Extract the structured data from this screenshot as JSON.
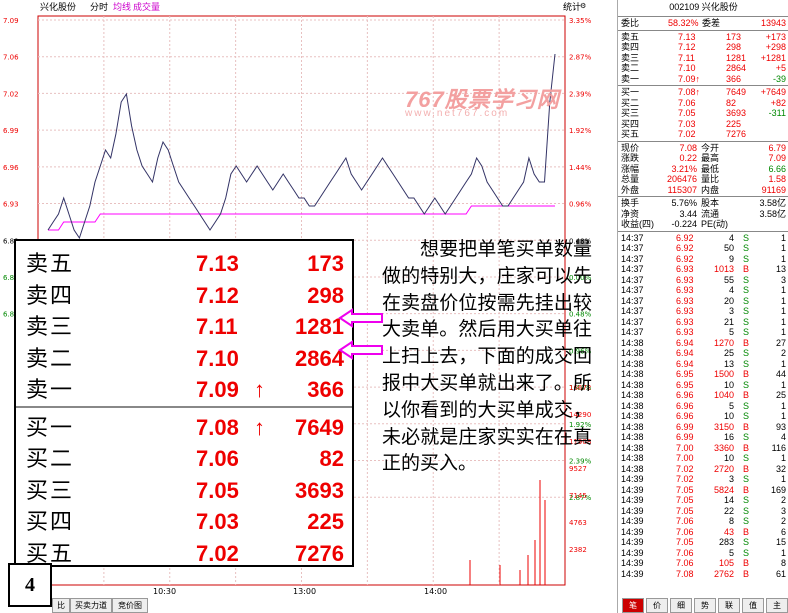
{
  "header": {
    "stock": "兴化股份",
    "tab_timeshare": "分时",
    "legend_avg": "均线",
    "legend_vol": "成交量",
    "stats_btn": "统计"
  },
  "chart_data": {
    "type": "line",
    "y_left_ticks": [
      "7.09",
      "7.06",
      "7.02",
      "6.99",
      "6.96",
      "6.93",
      "6.89",
      "6.86",
      "6.83"
    ],
    "y_right_ticks": [
      "3.35%",
      "2.87%",
      "2.39%",
      "1.92%",
      "1.44%",
      "0.96%",
      "0.48%",
      "0.00%",
      "0.48%",
      "0.96%",
      "1.44%",
      "1.92%",
      "2.39%",
      "2.87%"
    ],
    "vol_ticks": [
      "16672",
      "14290",
      "11908",
      "9527",
      "7145",
      "4763",
      "2382"
    ],
    "x_ticks": [
      "10:30",
      "13:00",
      "14:00"
    ],
    "ylim": [
      6.8,
      7.1
    ],
    "price": [
      6.86,
      6.87,
      6.88,
      6.9,
      6.88,
      6.86,
      6.85,
      6.87,
      6.89,
      6.92,
      6.94,
      6.96,
      6.95,
      6.98,
      7.02,
      7.03,
      6.99,
      6.96,
      6.94,
      6.93,
      6.92,
      6.95,
      6.97,
      6.96,
      6.94,
      6.92,
      6.91,
      6.9,
      6.89,
      6.88,
      6.87,
      6.86,
      6.87,
      6.88,
      6.9,
      6.93,
      6.94,
      6.93,
      6.92,
      6.93,
      6.94,
      6.93,
      6.92,
      6.91,
      6.92,
      6.93,
      6.92,
      6.91,
      6.9,
      6.9,
      6.89,
      6.89,
      6.9,
      6.91,
      6.92,
      6.93,
      6.94,
      6.95,
      6.93,
      6.92,
      6.91,
      6.92,
      6.93,
      6.94,
      6.95,
      6.94,
      6.93,
      6.92,
      6.91,
      6.9,
      6.9,
      6.89,
      6.88,
      6.89,
      6.9,
      6.89,
      6.88,
      6.89,
      6.9,
      6.91,
      6.92,
      6.93,
      6.95,
      6.94,
      6.92,
      6.91,
      6.9,
      6.89,
      6.89,
      6.9,
      6.91,
      6.92,
      6.95,
      6.93,
      6.92,
      6.92,
      7.02,
      7.08
    ],
    "avg": [
      6.86,
      6.86,
      6.86,
      6.87,
      6.87,
      6.87,
      6.87,
      6.87,
      6.87,
      6.87,
      6.88,
      6.88,
      6.88,
      6.88,
      6.88,
      6.88,
      6.88,
      6.88,
      6.88,
      6.88,
      6.88,
      6.88,
      6.88,
      6.88,
      6.88,
      6.88,
      6.88,
      6.88,
      6.88,
      6.88,
      6.88,
      6.88,
      6.88,
      6.88,
      6.88,
      6.88,
      6.88,
      6.88,
      6.88,
      6.88,
      6.88,
      6.88,
      6.88,
      6.88,
      6.88,
      6.88,
      6.88,
      6.88,
      6.88,
      6.88,
      6.88,
      6.88,
      6.88,
      6.88,
      6.88,
      6.88,
      6.88,
      6.88,
      6.88,
      6.88,
      6.88,
      6.88,
      6.88,
      6.88,
      6.88,
      6.88,
      6.88,
      6.88,
      6.88,
      6.88,
      6.88,
      6.88,
      6.88,
      6.88,
      6.88,
      6.88,
      6.88,
      6.88,
      6.88,
      6.88,
      6.88,
      6.89,
      6.89,
      6.89,
      6.89,
      6.89,
      6.89,
      6.89,
      6.89,
      6.89,
      6.89,
      6.89,
      6.89,
      6.89,
      6.89,
      6.89,
      6.89,
      6.89
    ]
  },
  "panel": {
    "title": "002109 兴化股份",
    "ratio": {
      "label": "委比",
      "value": "58.32%",
      "diff_label": "委差",
      "diff": "13943"
    },
    "sell": [
      {
        "label": "卖五",
        "price": "7.13",
        "vol": "173",
        "chg": "+173"
      },
      {
        "label": "卖四",
        "price": "7.12",
        "vol": "298",
        "chg": "+298"
      },
      {
        "label": "卖三",
        "price": "7.11",
        "vol": "1281",
        "chg": "+1281"
      },
      {
        "label": "卖二",
        "price": "7.10",
        "vol": "2864",
        "chg": "+5"
      },
      {
        "label": "卖一",
        "price": "7.09↑",
        "vol": "366",
        "chg": "-39"
      }
    ],
    "buy": [
      {
        "label": "买一",
        "price": "7.08↑",
        "vol": "7649",
        "chg": "+7649"
      },
      {
        "label": "买二",
        "price": "7.06",
        "vol": "82",
        "chg": "+82"
      },
      {
        "label": "买三",
        "price": "7.05",
        "vol": "3693",
        "chg": "-311"
      },
      {
        "label": "买四",
        "price": "7.03",
        "vol": "225",
        "chg": ""
      },
      {
        "label": "买五",
        "price": "7.02",
        "vol": "7276",
        "chg": ""
      }
    ],
    "stats": [
      {
        "l1": "现价",
        "v1": "7.08",
        "l2": "今开",
        "v2": "6.79"
      },
      {
        "l1": "涨跌",
        "v1": "0.22",
        "l2": "最高",
        "v2": "7.09"
      },
      {
        "l1": "涨幅",
        "v1": "3.21%",
        "l2": "最低",
        "v2": "6.66"
      },
      {
        "l1": "总量",
        "v1": "206476",
        "l2": "量比",
        "v2": "1.58"
      },
      {
        "l1": "外盘",
        "v1": "115307",
        "l2": "内盘",
        "v2": "91169"
      }
    ],
    "stats2": [
      {
        "l1": "换手",
        "v1": "5.76%",
        "l2": "股本",
        "v2": "3.58亿"
      },
      {
        "l1": "净资",
        "v1": "3.44",
        "l2": "流通",
        "v2": "3.58亿"
      },
      {
        "l1": "收益(四)",
        "v1": "-0.224",
        "l2": "PE(动)",
        "v2": ""
      }
    ],
    "ticks": [
      [
        "14:37",
        "6.92",
        "4",
        "S",
        "1"
      ],
      [
        "14:37",
        "6.92",
        "50",
        "S",
        "1"
      ],
      [
        "14:37",
        "6.92",
        "9",
        "S",
        "1"
      ],
      [
        "14:37",
        "6.93",
        "1013",
        "B",
        "13"
      ],
      [
        "14:37",
        "6.93",
        "55",
        "S",
        "3"
      ],
      [
        "14:37",
        "6.93",
        "4",
        "S",
        "1"
      ],
      [
        "14:37",
        "6.93",
        "20",
        "S",
        "1"
      ],
      [
        "14:37",
        "6.93",
        "3",
        "S",
        "1"
      ],
      [
        "14:37",
        "6.93",
        "21",
        "S",
        "1"
      ],
      [
        "14:37",
        "6.93",
        "5",
        "S",
        "1"
      ],
      [
        "14:38",
        "6.94",
        "1270",
        "B",
        "27"
      ],
      [
        "14:38",
        "6.94",
        "25",
        "S",
        "2"
      ],
      [
        "14:38",
        "6.94",
        "13",
        "S",
        "1"
      ],
      [
        "14:38",
        "6.95",
        "1500",
        "B",
        "44"
      ],
      [
        "14:38",
        "6.95",
        "10",
        "S",
        "1"
      ],
      [
        "14:38",
        "6.96",
        "1040",
        "B",
        "25"
      ],
      [
        "14:38",
        "6.96",
        "5",
        "S",
        "1"
      ],
      [
        "14:38",
        "6.96",
        "10",
        "S",
        "1"
      ],
      [
        "14:38",
        "6.99",
        "3150",
        "B",
        "93"
      ],
      [
        "14:38",
        "6.99",
        "16",
        "S",
        "4"
      ],
      [
        "14:38",
        "7.00",
        "3360",
        "B",
        "116"
      ],
      [
        "14:38",
        "7.00",
        "10",
        "S",
        "1"
      ],
      [
        "14:38",
        "7.02",
        "2720",
        "B",
        "32"
      ],
      [
        "14:39",
        "7.02",
        "3",
        "S",
        "1"
      ],
      [
        "14:39",
        "7.05",
        "5824",
        "B",
        "169"
      ],
      [
        "14:39",
        "7.05",
        "14",
        "S",
        "2"
      ],
      [
        "14:39",
        "7.05",
        "22",
        "S",
        "3"
      ],
      [
        "14:39",
        "7.06",
        "8",
        "S",
        "2"
      ],
      [
        "14:39",
        "7.06",
        "43",
        "B",
        "6"
      ],
      [
        "14:39",
        "7.05",
        "283",
        "S",
        "15"
      ],
      [
        "14:39",
        "7.06",
        "5",
        "S",
        "1"
      ],
      [
        "14:39",
        "7.06",
        "105",
        "B",
        "8"
      ],
      [
        "14:39",
        "7.08",
        "2762",
        "B",
        "61"
      ]
    ],
    "bottom_tabs": [
      "笔",
      "价",
      "细",
      "势",
      "联",
      "值",
      "主"
    ]
  },
  "overlay": {
    "rows": [
      {
        "label": "卖五",
        "price": "7.13",
        "vol": "173"
      },
      {
        "label": "卖四",
        "price": "7.12",
        "vol": "298"
      },
      {
        "label": "卖三",
        "price": "7.11",
        "vol": "1281"
      },
      {
        "label": "卖二",
        "price": "7.10",
        "vol": "2864"
      },
      {
        "label": "卖一",
        "price": "7.09",
        "vol": "366"
      },
      {
        "label": "买一",
        "price": "7.08",
        "vol": "7649"
      },
      {
        "label": "买二",
        "price": "7.06",
        "vol": "82"
      },
      {
        "label": "买三",
        "price": "7.05",
        "vol": "3693"
      },
      {
        "label": "买四",
        "price": "7.03",
        "vol": "225"
      },
      {
        "label": "买五",
        "price": "7.02",
        "vol": "7276"
      }
    ],
    "number": "4",
    "paragraph": "想要把单笔买单数量做的特别大，庄家可以先在卖盘价位按需先挂出较大卖单。然后用大买单往上扫上去，下面的成交回报中大买单就出来了。所以你看到的大买单成交，未必就是庄家实实在在真正的买入。",
    "watermark": "767股票学习网",
    "watermark_url": "www.net767.com"
  },
  "bottom_tabs_left": [
    "比",
    "买卖力道",
    "竞价图"
  ],
  "colors": {
    "price_line": "#333366",
    "avg_line": "#ff00ff",
    "red": "#ee0000",
    "green": "#008800"
  }
}
